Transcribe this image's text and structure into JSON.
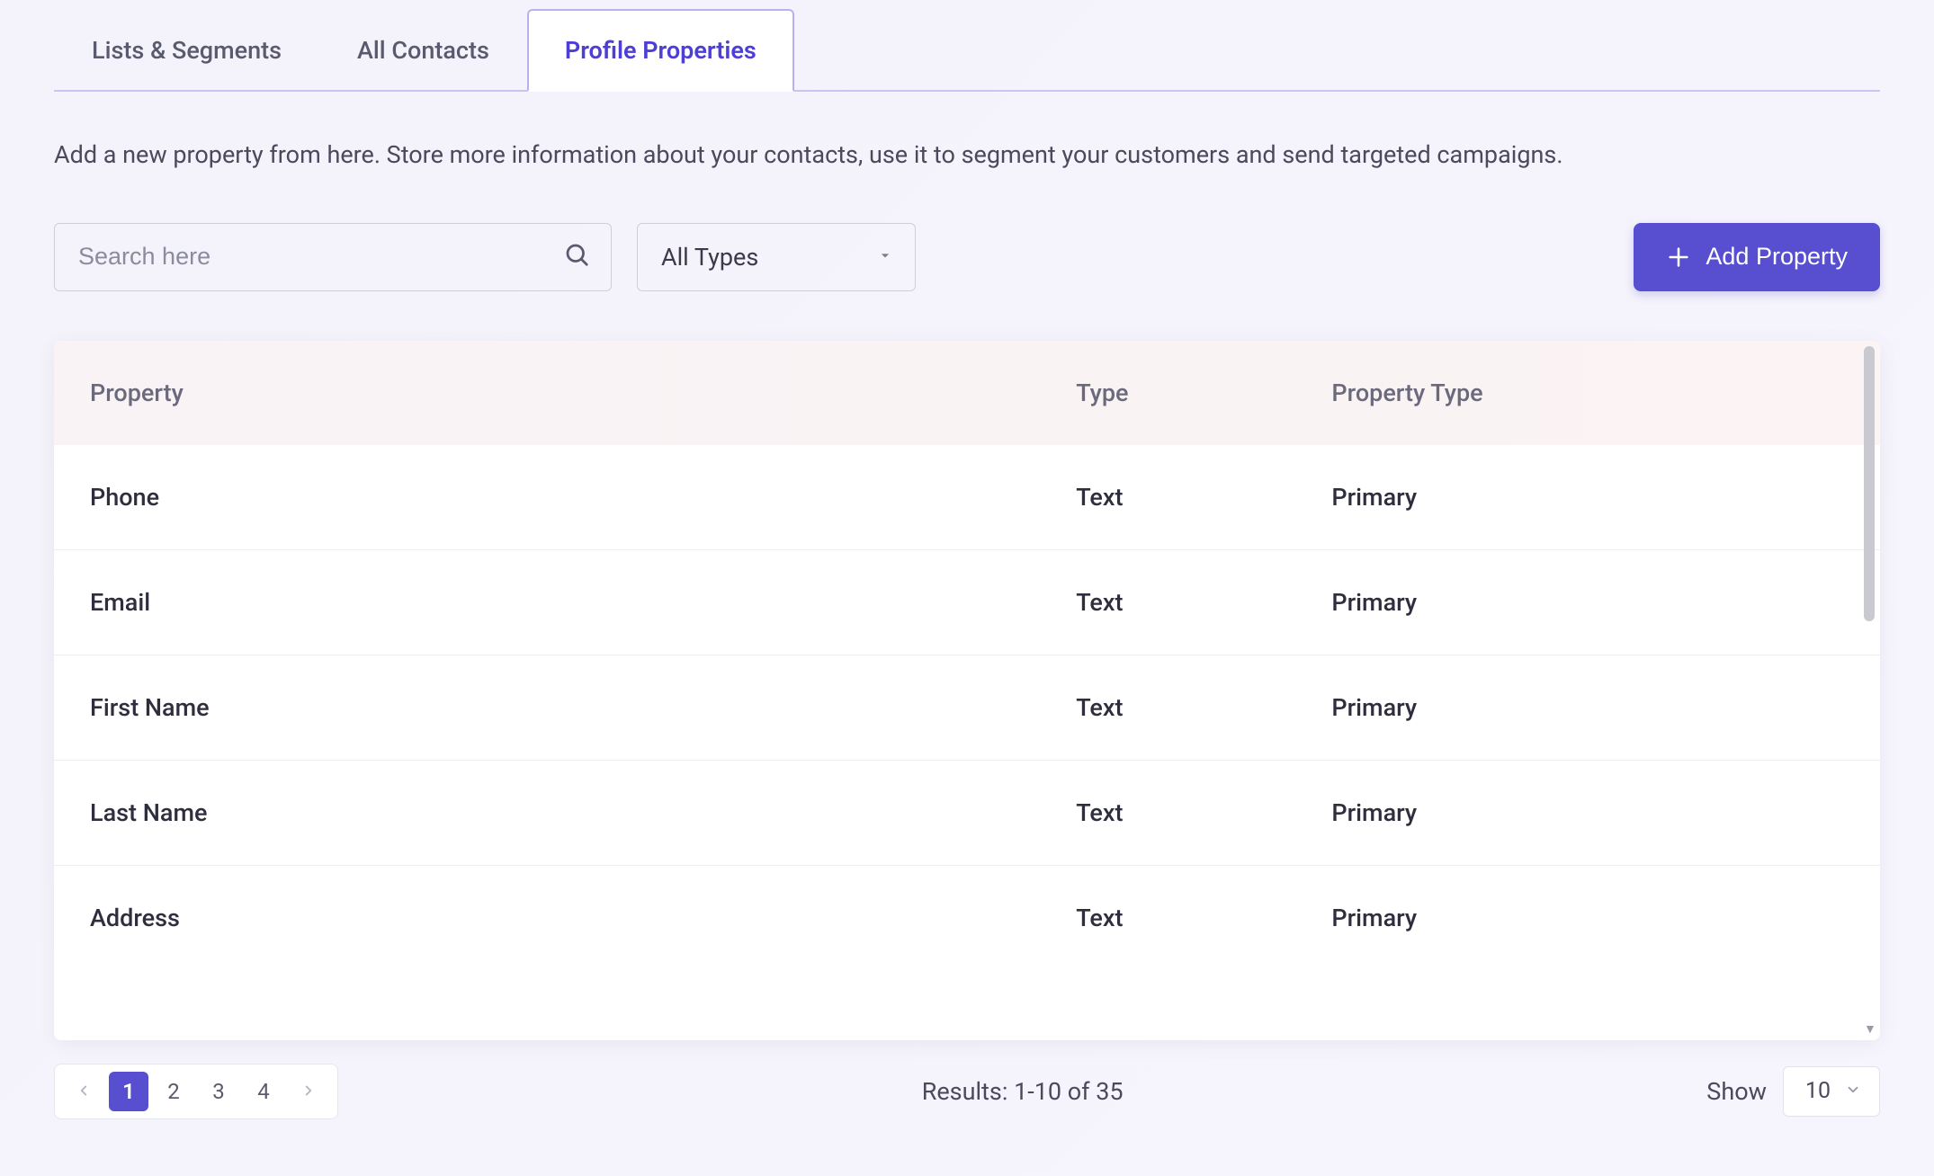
{
  "tabs": {
    "lists_segments": "Lists & Segments",
    "all_contacts": "All Contacts",
    "profile_properties": "Profile Properties"
  },
  "description": "Add a new property from here. Store more information about your contacts, use it to segment your customers and send targeted campaigns.",
  "search": {
    "placeholder": "Search here"
  },
  "type_filter": {
    "selected": "All Types"
  },
  "add_button": {
    "label": "Add Property"
  },
  "table": {
    "headers": {
      "property": "Property",
      "type": "Type",
      "property_type": "Property Type"
    },
    "rows": [
      {
        "property": "Phone",
        "type": "Text",
        "property_type": "Primary"
      },
      {
        "property": "Email",
        "type": "Text",
        "property_type": "Primary"
      },
      {
        "property": "First Name",
        "type": "Text",
        "property_type": "Primary"
      },
      {
        "property": "Last Name",
        "type": "Text",
        "property_type": "Primary"
      },
      {
        "property": "Address",
        "type": "Text",
        "property_type": "Primary"
      }
    ]
  },
  "pagination": {
    "pages": [
      "1",
      "2",
      "3",
      "4"
    ],
    "active_index": 0,
    "results_text": "Results: 1-10 of 35",
    "show_label": "Show",
    "show_value": "10"
  }
}
